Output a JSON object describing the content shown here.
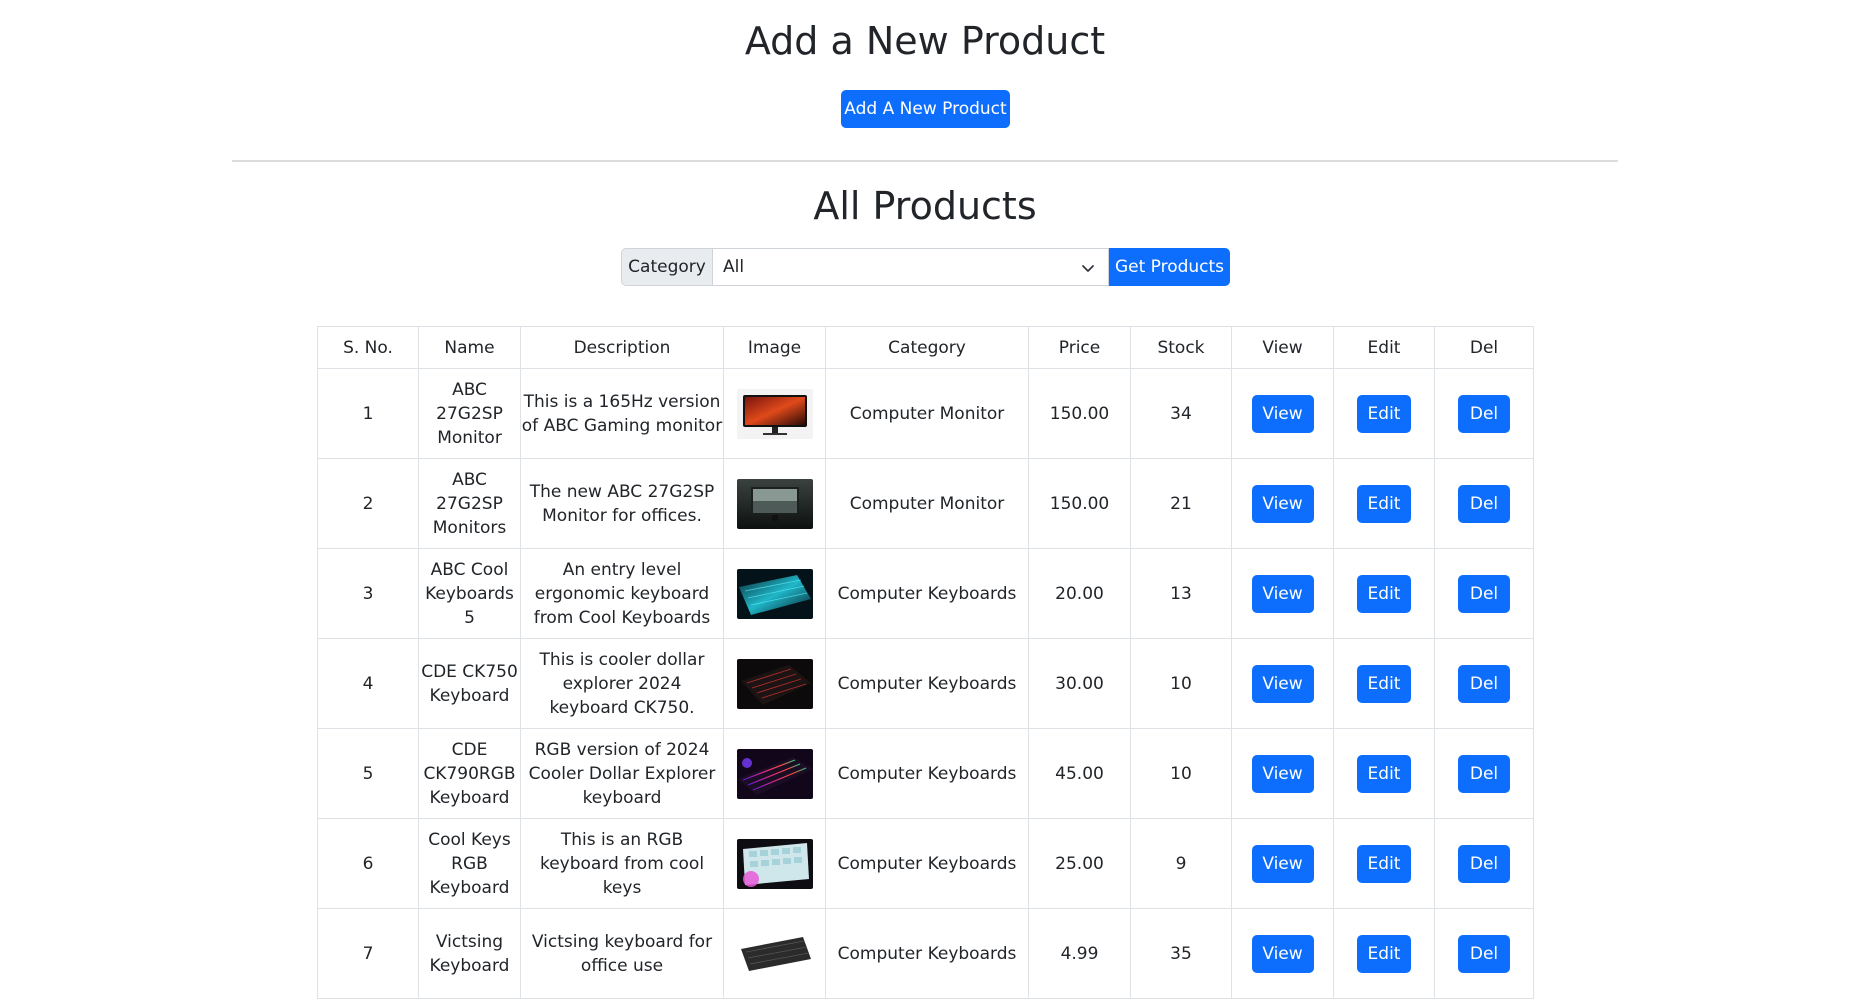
{
  "header": {
    "add_title": "Add a New Product",
    "add_button": "Add A New Product"
  },
  "products_section": {
    "title": "All Products",
    "filter": {
      "label": "Category",
      "selected": "All",
      "button": "Get Products"
    }
  },
  "table": {
    "headers": [
      "S. No.",
      "Name",
      "Description",
      "Image",
      "Category",
      "Price",
      "Stock",
      "View",
      "Edit",
      "Del"
    ],
    "rows": [
      {
        "sno": "1",
        "name": "ABC 27G2SP Monitor",
        "description": "This is a 165Hz version of ABC Gaming monitor",
        "image": "monitor-red-thumbnail",
        "category": "Computer Monitor",
        "price": "150.00",
        "stock": "34",
        "view": "View",
        "edit": "Edit",
        "del": "Del"
      },
      {
        "sno": "2",
        "name": "ABC 27G2SP Monitors",
        "description": "The new ABC 27G2SP Monitor for offices.",
        "image": "monitor-dark-thumbnail",
        "category": "Computer Monitor",
        "price": "150.00",
        "stock": "21",
        "view": "View",
        "edit": "Edit",
        "del": "Del"
      },
      {
        "sno": "3",
        "name": "ABC Cool Keyboards 5",
        "description": "An entry level ergonomic keyboard from Cool Keyboards",
        "image": "keyboard-cyan-thumbnail",
        "category": "Computer Keyboards",
        "price": "20.00",
        "stock": "13",
        "view": "View",
        "edit": "Edit",
        "del": "Del"
      },
      {
        "sno": "4",
        "name": "CDE CK750 Keyboard",
        "description": "This is cooler dollar explorer 2024 keyboard CK750.",
        "image": "keyboard-red-thumbnail",
        "category": "Computer Keyboards",
        "price": "30.00",
        "stock": "10",
        "view": "View",
        "edit": "Edit",
        "del": "Del"
      },
      {
        "sno": "5",
        "name": "CDE CK790RGB Keyboard",
        "description": "RGB version of 2024 Cooler Dollar Explorer keyboard",
        "image": "keyboard-rgb-thumbnail",
        "category": "Computer Keyboards",
        "price": "45.00",
        "stock": "10",
        "view": "View",
        "edit": "Edit",
        "del": "Del"
      },
      {
        "sno": "6",
        "name": "Cool Keys RGB Keyboard",
        "description": "This is an RGB keyboard from cool keys",
        "image": "keyboard-pastel-thumbnail",
        "category": "Computer Keyboards",
        "price": "25.00",
        "stock": "9",
        "view": "View",
        "edit": "Edit",
        "del": "Del"
      },
      {
        "sno": "7",
        "name": "Victsing Keyboard",
        "description": "Victsing keyboard for office use",
        "image": "keyboard-black-thumbnail",
        "category": "Computer Keyboards",
        "price": "4.99",
        "stock": "35",
        "view": "View",
        "edit": "Edit",
        "del": "Del"
      }
    ]
  }
}
